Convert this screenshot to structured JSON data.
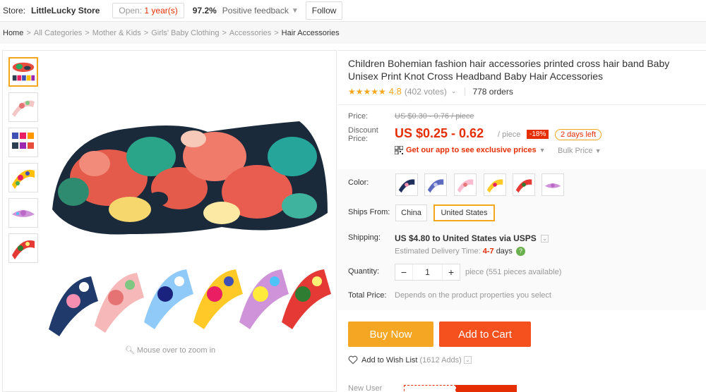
{
  "store": {
    "label": "Store:",
    "name": "LittleLucky Store",
    "open_prefix": "Open:",
    "open_years": "1 year(s)",
    "feedback_pct": "97.2%",
    "feedback_label": "Positive feedback",
    "follow_label": "Follow"
  },
  "breadcrumb": [
    "Home",
    "All Categories",
    "Mother & Kids",
    "Girls' Baby Clothing",
    "Accessories",
    "Hair Accessories"
  ],
  "gallery": {
    "zoom_hint": "Mouse over to zoom in"
  },
  "product": {
    "title": "Children Bohemian fashion hair accessories printed cross hair band Baby Unisex Print Knot Cross Headband Baby Hair Accessories",
    "rating": "4.8",
    "votes": "(402 votes)",
    "orders": "778 orders",
    "price_label": "Price:",
    "old_price": "US $0.30 - 0.76 / piece",
    "discount_label": "Discount Price:",
    "discount_price": "US $0.25 - 0.62",
    "per_piece": "/ piece",
    "discount_pct": "-18%",
    "days_left": "2 days left",
    "app_offer": "Get our app to see exclusive prices",
    "bulk_price": "Bulk Price"
  },
  "options": {
    "color_label": "Color:",
    "ships_from_label": "Ships From:",
    "ships_from": [
      "China",
      "United States"
    ],
    "ships_from_selected": "United States",
    "shipping_label": "Shipping:",
    "shipping_price": "US $4.80",
    "shipping_to": "to United States via USPS",
    "eta_label": "Estimated Delivery Time:",
    "eta_days": "4-7",
    "eta_unit": "days",
    "quantity_label": "Quantity:",
    "quantity": "1",
    "pieces_available": "piece (551 pieces available)",
    "total_label": "Total Price:",
    "total_text": "Depends on the product properties you select"
  },
  "actions": {
    "buy_now": "Buy Now",
    "add_to_cart": "Add to Cart",
    "wish_list": "Add to Wish List",
    "wish_adds": "(1612 Adds)",
    "new_user": "New User"
  },
  "colors": {
    "accent": "#e62e04",
    "star": "#f4a71d",
    "buy": "#f5a623",
    "cart": "#f4511e"
  }
}
